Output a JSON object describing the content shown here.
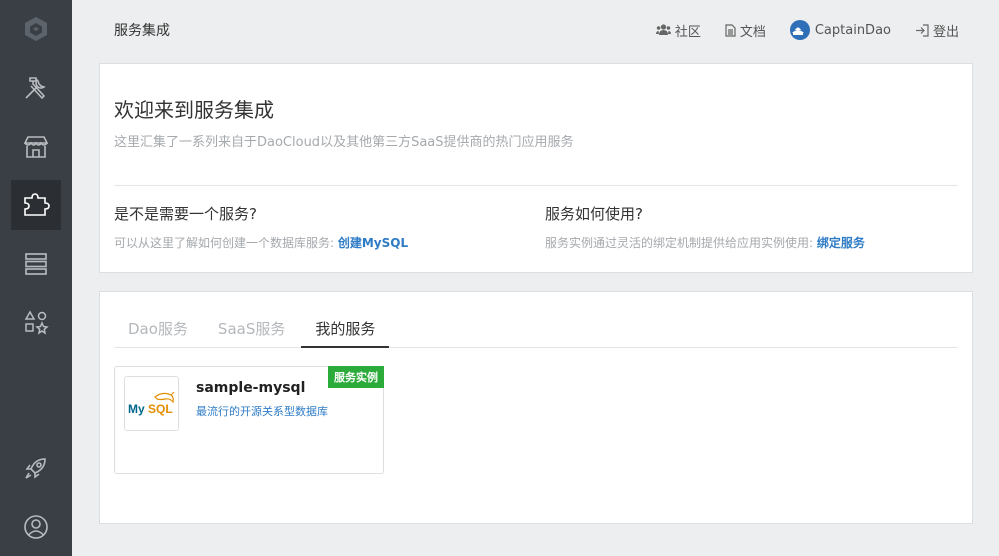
{
  "header": {
    "title": "服务集成",
    "community": "社区",
    "docs": "文档",
    "user": "CaptainDao",
    "logout": "登出"
  },
  "welcome": {
    "title": "欢迎来到服务集成",
    "description": "这里汇集了一系列来自于DaoCloud以及其他第三方SaaS提供商的热门应用服务",
    "left": {
      "title": "是不是需要一个服务?",
      "text": "可以从这里了解如何创建一个数据库服务: ",
      "link": "创建MySQL"
    },
    "right": {
      "title": "服务如何使用?",
      "text": "服务实例通过灵活的绑定机制提供给应用实例使用: ",
      "link": "绑定服务"
    }
  },
  "tabs": [
    "Dao服务",
    "SaaS服务",
    "我的服务"
  ],
  "active_tab": 2,
  "service": {
    "name": "sample-mysql",
    "description": "最流行的开源关系型数据库",
    "badge": "服务实例",
    "logo_text_my": "My",
    "logo_text_sql": "SQL"
  },
  "colors": {
    "sidebar": "#3a3f45",
    "accent_blue": "#2f7cc6",
    "badge_green": "#2bab3a"
  },
  "icons": {
    "sidebar": [
      "logo-icon",
      "tools-icon",
      "store-icon",
      "puzzle-icon",
      "server-icon",
      "shapes-icon",
      "rocket-icon",
      "user-icon"
    ],
    "header": [
      "users-icon",
      "document-icon",
      "user-avatar-icon",
      "logout-icon"
    ]
  }
}
